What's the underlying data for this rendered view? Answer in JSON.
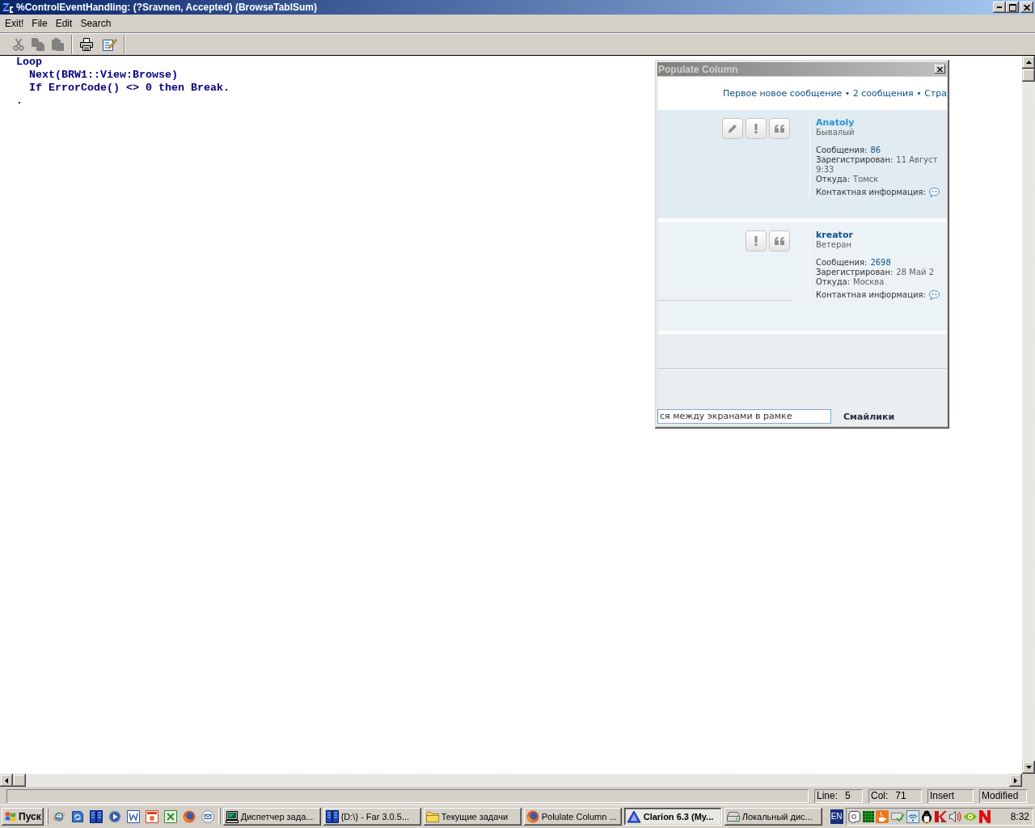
{
  "window": {
    "title": "%ControlEventHandling: (?Sravnen, Accepted) (BrowseTablSum)"
  },
  "menu": [
    {
      "label": "Exit!"
    },
    {
      "label": "File"
    },
    {
      "label": "Edit"
    },
    {
      "label": "Search"
    }
  ],
  "toolbar": [
    {
      "disabled": true
    },
    {
      "disabled": true
    },
    {
      "disabled": true
    },
    {
      "disabled": false
    },
    {
      "disabled": false
    }
  ],
  "editor": {
    "lines": [
      {
        "text": "Loop",
        "children": [
          {
            "text": "Next(BRW1::View:Browse)"
          },
          {
            "text": "If ErrorCode() <> 0 then Break."
          }
        ]
      },
      {
        "text": "."
      }
    ]
  },
  "popup": {
    "title": "Populate Column",
    "topic_info": "Первое новое сообщение • 2 сообщения • Стра",
    "posts": [
      {
        "author": "Anatoly",
        "color": "#2a93d5",
        "rank": "Бывалый",
        "separator": false,
        "actions": [
          {
            "kind": "edit"
          },
          {
            "kind": "report"
          },
          {
            "kind": "quote"
          }
        ],
        "fields": [
          {
            "kind": "count",
            "label": "Сообщения:",
            "value": "86"
          },
          {
            "kind": "text",
            "label": "Зарегистрирован:",
            "value": "11 Август",
            "value_line_2": "9:33"
          },
          {
            "kind": "text",
            "label": "Откуда:",
            "value": "Томск"
          },
          {
            "kind": "contact",
            "label": "Контактная информация:"
          }
        ]
      },
      {
        "author": "kreator",
        "color": "#105289",
        "rank": "Ветеран",
        "separator": true,
        "actions": [
          {
            "kind": "report"
          },
          {
            "kind": "quote"
          }
        ],
        "fields": [
          {
            "kind": "count",
            "label": "Сообщения:",
            "value": "2698"
          },
          {
            "kind": "text",
            "label": "Зарегистрирован:",
            "value": "28 Май 2"
          },
          {
            "kind": "text",
            "label": "Откуда:",
            "value": "Москва"
          },
          {
            "kind": "contact",
            "label": "Контактная информация:"
          }
        ]
      }
    ],
    "reply": {
      "value": "ся между экранами в рамке",
      "smilies_heading": "Смайлики"
    }
  },
  "status_bar": {
    "panes": [
      {
        "label": "Line:",
        "value": "5"
      },
      {
        "label": "Col:",
        "value": "71"
      },
      {
        "label": "Insert"
      },
      {
        "label": "Modified"
      }
    ]
  },
  "taskbar": {
    "start": "Пуск",
    "tasks": [
      {
        "label": "Диспетчер зада...",
        "selected": false
      },
      {
        "label": "{D:\\} - Far 3.0.5...",
        "selected": false
      },
      {
        "label": "Текущие задачи",
        "selected": false
      },
      {
        "label": "Polulate Column ...",
        "selected": false
      },
      {
        "label": "Clarion 6.3 (My...",
        "selected": true
      },
      {
        "label": "Локальный дис...",
        "selected": false
      }
    ],
    "language": "EN",
    "clock": "8:32"
  }
}
